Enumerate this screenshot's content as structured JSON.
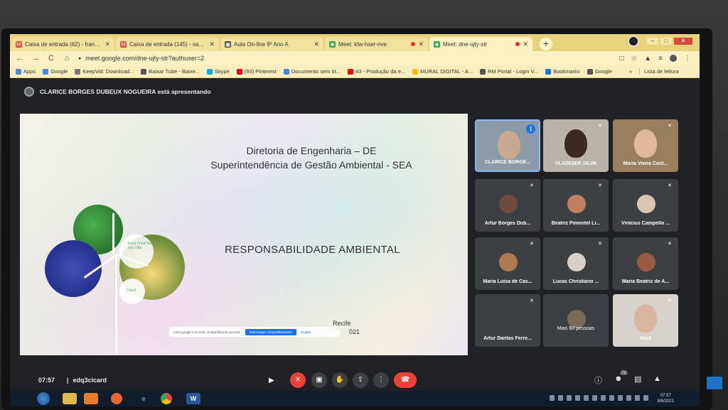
{
  "browser": {
    "tabs": [
      {
        "label": "Caixa de entrada (62) - francesa:",
        "fav_color": "#ea4335",
        "fav_glyph": "M",
        "active": false,
        "recording": false
      },
      {
        "label": "Caixa de entrada (145) - sameafa:",
        "fav_color": "#ea4335",
        "fav_glyph": "M",
        "active": false,
        "recording": false
      },
      {
        "label": "Aula On-line 9º Ano A",
        "fav_color": "#444444",
        "fav_glyph": "▣",
        "active": false,
        "recording": false
      },
      {
        "label": "Meet: kfw-hser-nve",
        "fav_color": "#34a853",
        "fav_glyph": "■",
        "active": false,
        "recording": true
      },
      {
        "label": "Meet: dne-ujty-str",
        "fav_color": "#34a853",
        "fav_glyph": "■",
        "active": true,
        "recording": true
      }
    ],
    "new_tab": "+",
    "window_controls": {
      "minimize": "–",
      "maximize": "□",
      "close": "✕"
    },
    "address": {
      "back": "←",
      "forward": "→",
      "reload": "C",
      "home": "⌂",
      "lock": "🔒",
      "url": "meet.google.com/dne-ujty-str?authuser=2"
    },
    "bookmarks": [
      {
        "label": "Apps",
        "color": "#4285f4"
      },
      {
        "label": "Google",
        "color": "#4285f4"
      },
      {
        "label": "KeepVid: Download...",
        "color": "#777777"
      },
      {
        "label": "Baixar Tube - Baixe...",
        "color": "#555555"
      },
      {
        "label": "Skype",
        "color": "#00aff0"
      },
      {
        "label": "(93) Pinterest",
        "color": "#e60023"
      },
      {
        "label": "Documento sem tít...",
        "color": "#4285f4"
      },
      {
        "label": "43 - Produção da e...",
        "color": "#ff0000"
      },
      {
        "label": "MURAL DIGITAL - A...",
        "color": "#fbbc04"
      },
      {
        "label": "RM Portal - Login V...",
        "color": "#555555"
      },
      {
        "label": "Bookmarks",
        "color": "#1a73e8"
      },
      {
        "label": "Google",
        "color": "#555555"
      }
    ],
    "bookmarks_more": "»",
    "reading_list": "Lista de leitura"
  },
  "meet": {
    "presenter_text": "CLARICE BORGES DUBEUX NOGUEIRA está apresentando",
    "slide": {
      "title_line1": "Diretoria de Engenharia – DE",
      "title_line2": "Superintendência de Gestão Ambiental - SEA",
      "heading": "RESPONSABILIDADE AMBIENTAL",
      "city": "Recife",
      "year": "021",
      "bubble_text": "Essa Chesf faz sua Vida",
      "bubble_brand": "Chesf",
      "share_notice": "meet.google.com está compartilhando sua tela.",
      "stop_sharing": "Interromper compartilhamento",
      "hide": "Ocultar"
    },
    "participants": [
      {
        "name": "CLARICE BORGE...",
        "video": true,
        "speaking": true,
        "bg": "#8a9aa6",
        "face": "#c9a890"
      },
      {
        "name": "VLADEMIR SILVA",
        "video": true,
        "speaking": false,
        "bg": "#b9b3aa",
        "face": "#3a2a22"
      },
      {
        "name": "Maria Vieira Cost...",
        "video": true,
        "speaking": false,
        "bg": "#9a7f5e",
        "face": "#e0b89a"
      },
      {
        "name": "Artur Borges Dub...",
        "video": false,
        "avatar": "#6d4c3d"
      },
      {
        "name": "Beatriz Pimentel Li...",
        "video": false,
        "avatar": "#c08060"
      },
      {
        "name": "Vinícius Campello ...",
        "video": false,
        "avatar": "#d9c6b0"
      },
      {
        "name": "Maria Luísa de Cas...",
        "video": false,
        "avatar": "#b07a50"
      },
      {
        "name": "Lucas Christiano ...",
        "video": false,
        "avatar": "#d6d0c8"
      },
      {
        "name": "Maria Beatriz de A...",
        "video": false,
        "avatar": "#9a5a40"
      },
      {
        "name": "Artur Dantas Ferre...",
        "video": false,
        "avatar": ""
      },
      {
        "name": "Mais 60 pessoas",
        "video": false,
        "avatar": "#7a6a5a"
      },
      {
        "name": "Você",
        "video": true,
        "speaking": false,
        "bg": "#d8d2cc",
        "face": "#d9b5a0"
      }
    ],
    "bar": {
      "time": "07:57",
      "separator": "|",
      "code": "edq3cicard",
      "participant_count": "72"
    },
    "icons": {
      "mic_off": "🎙",
      "camera": "▭",
      "hand": "✋",
      "present": "⇪",
      "more": "⋮",
      "hangup": "☎",
      "info": "ⓘ",
      "people": "👥",
      "chat": "💬",
      "activities": "⛭",
      "muted": "✕"
    }
  },
  "taskbar": {
    "time": "07:57",
    "date": "8/6/2021",
    "apps": [
      "start-orb",
      "explorer",
      "media",
      "firefox",
      "ie",
      "chrome",
      "word"
    ]
  }
}
